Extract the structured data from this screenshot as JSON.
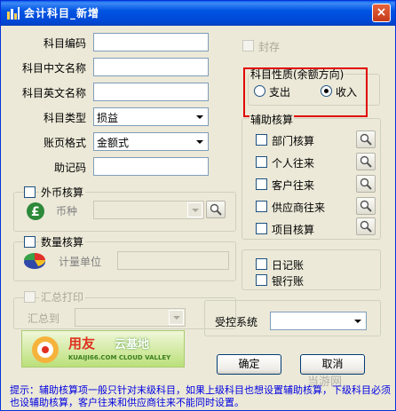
{
  "window": {
    "title": "会计科目_新增",
    "close": "×"
  },
  "form": {
    "code_label": "科目编码",
    "cn_name_label": "科目中文名称",
    "en_name_label": "科目英文名称",
    "type_label": "科目类型",
    "type_value": "损益",
    "ledger_format_label": "账页格式",
    "ledger_format_value": "金额式",
    "mnemonic_label": "助记码",
    "seal_label": "封存"
  },
  "nature": {
    "title": "科目性质(余额方向)",
    "debit_label": "支出",
    "credit_label": "收入",
    "selected": "收入"
  },
  "auxiliary": {
    "title": "辅助核算",
    "items": [
      {
        "label": "部门核算"
      },
      {
        "label": "个人往来"
      },
      {
        "label": "客户往来"
      },
      {
        "label": "供应商往来"
      },
      {
        "label": "项目核算"
      }
    ]
  },
  "foreign": {
    "title": "外币核算",
    "currency_label": "币种"
  },
  "quantity": {
    "title": "数量核算",
    "unit_label": "计量单位"
  },
  "journal": {
    "daily_label": "日记账",
    "bank_label": "银行账"
  },
  "summary": {
    "title": "汇总打印",
    "to_label": "汇总到"
  },
  "controlled": {
    "label": "受控系统"
  },
  "buttons": {
    "ok": "确定",
    "cancel": "取消"
  },
  "banner": {
    "brand": "用友",
    "sub": "云基地",
    "url": "KUAIJI66.COM CLOUD VALLEY"
  },
  "hint": "提示：辅助核算项一般只针对末级科目，如果上级科目也想设置辅助核算，下级科目必须也设辅助核算，客户往来和供应商往来不能同时设置。",
  "watermark": "当游网",
  "colors": {
    "titlebar": "#0054E3",
    "dialog_bg": "#ECE9D8",
    "hint_text": "#0000E0",
    "highlight_box": "#E00000"
  }
}
